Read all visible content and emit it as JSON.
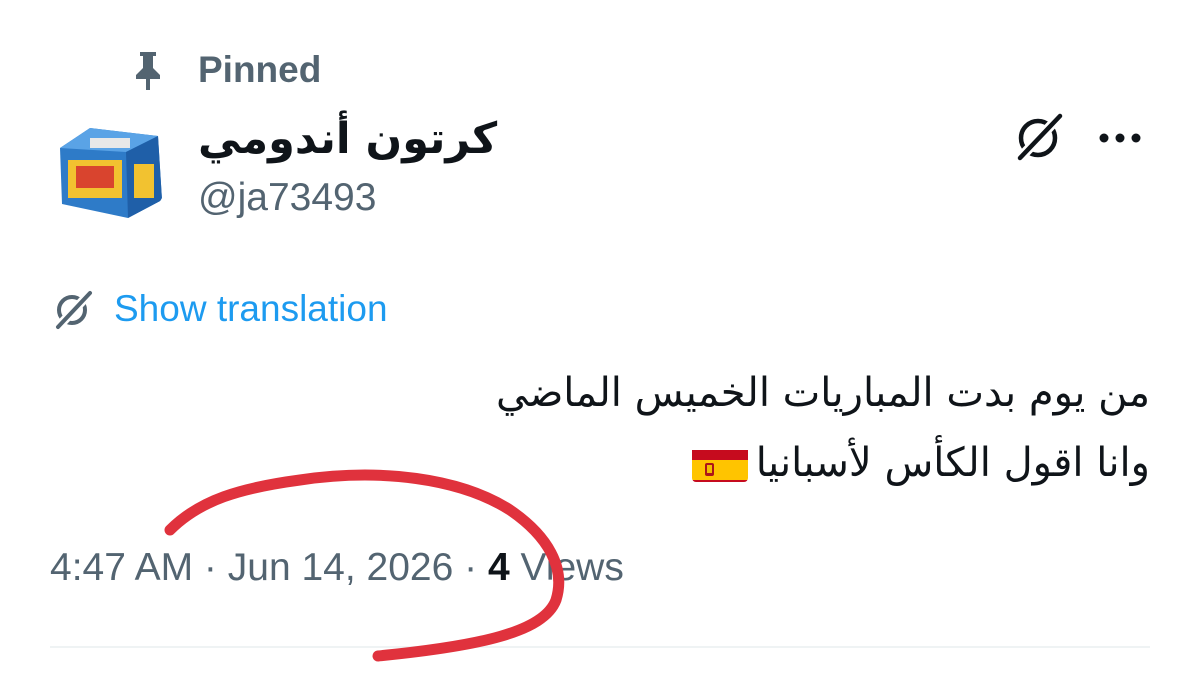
{
  "pinned": {
    "label": "Pinned",
    "icon": "pin-icon"
  },
  "author": {
    "display_name": "كرتون أندومي",
    "handle": "@ja73493",
    "avatar": "avatar"
  },
  "actions": {
    "grok_icon": "grok-icon",
    "more_icon": "more-icon"
  },
  "translation": {
    "label": "Show translation",
    "icon": "grok-icon"
  },
  "tweet": {
    "line1": "من يوم بدت المباريات الخميس الماضي",
    "line2": "وانا اقول الكأس لأسبانيا",
    "emoji": "spain-flag"
  },
  "meta": {
    "time": "4:47 AM",
    "sep1": " · ",
    "date": "Jun 14, 2026",
    "sep2": " · ",
    "views_count": "4",
    "views_label": " Views"
  },
  "colors": {
    "text": "#0f1419",
    "secondary": "#536471",
    "link": "#1d9bf0",
    "annotation": "#e0323d",
    "divider": "#eff3f4"
  }
}
